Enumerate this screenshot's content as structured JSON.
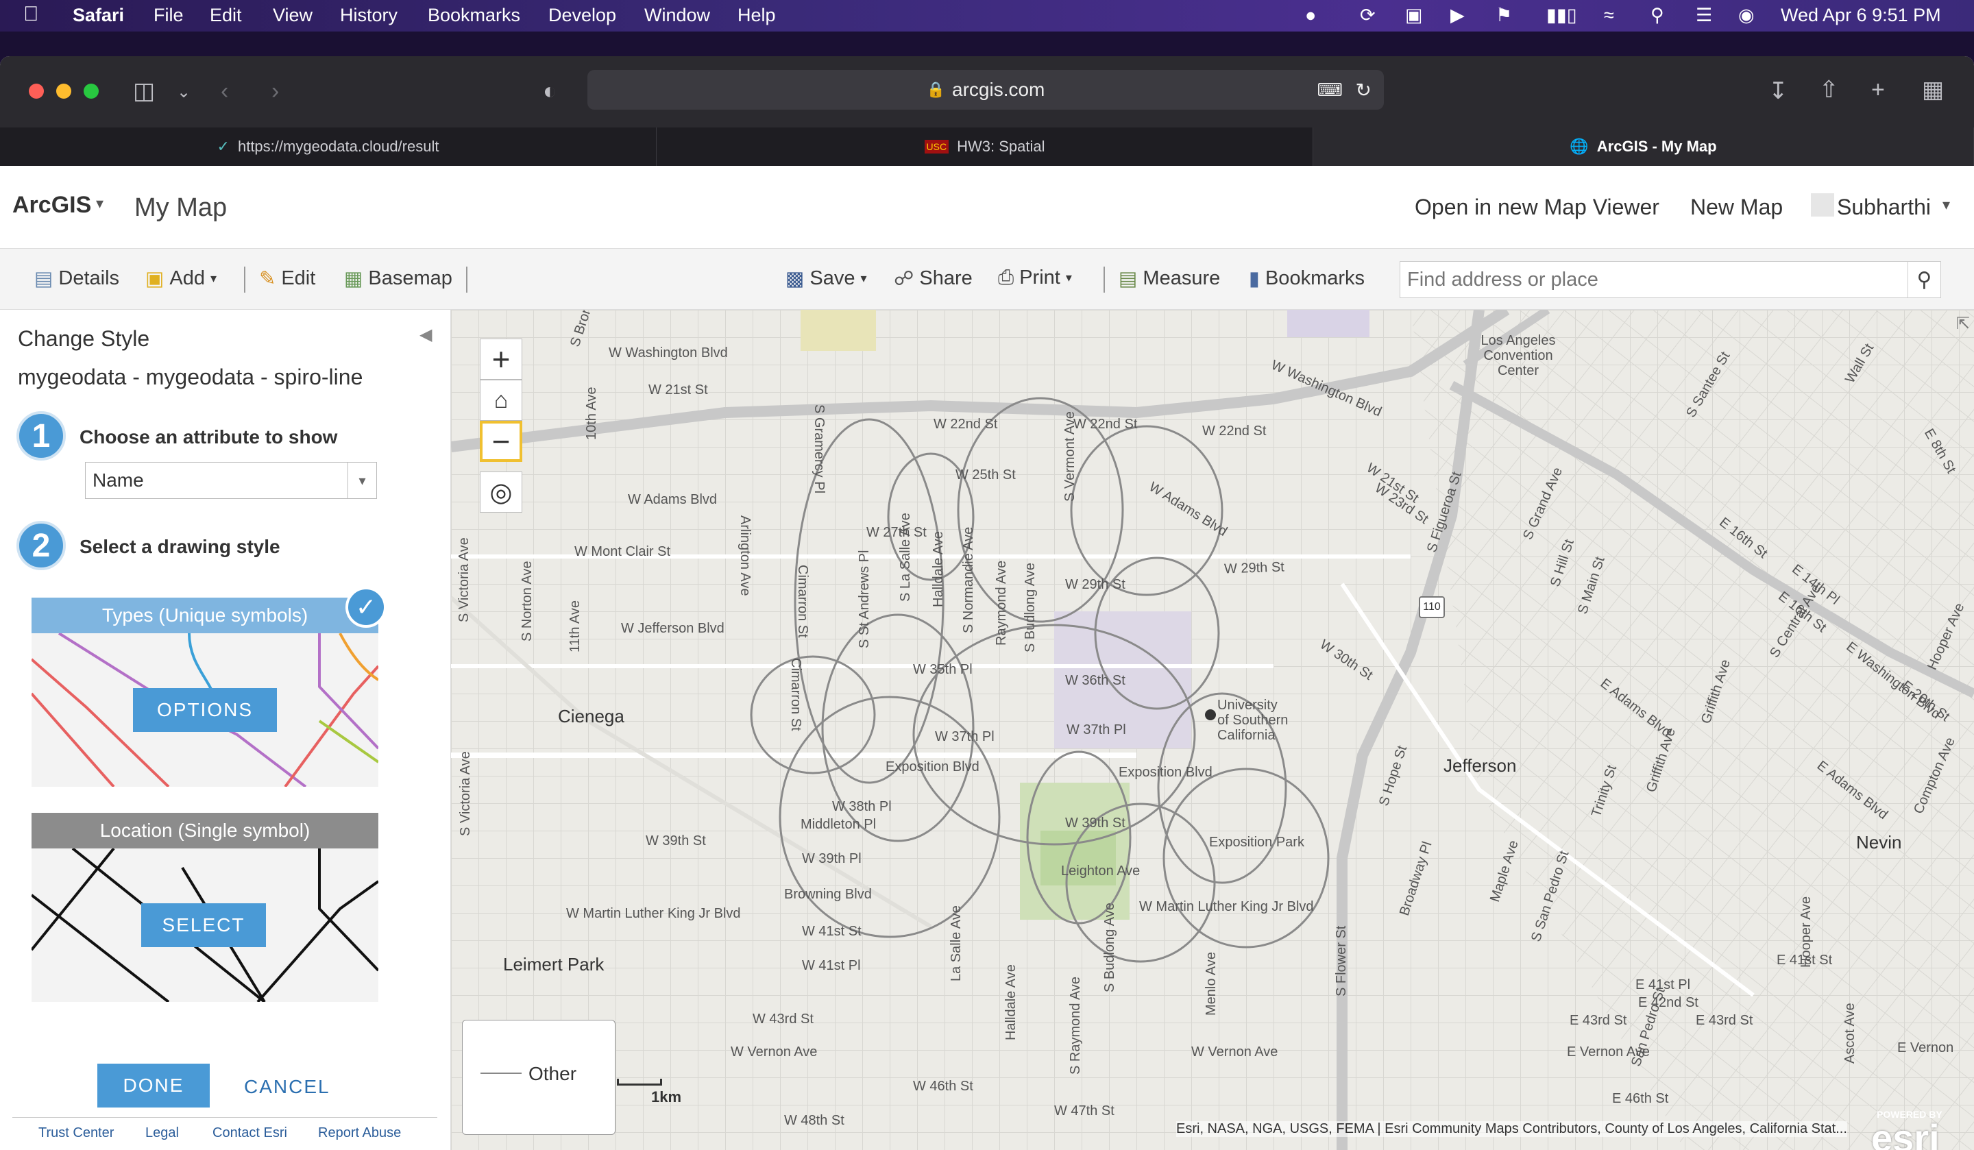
{
  "menubar": {
    "app": "Safari",
    "items": [
      "File",
      "Edit",
      "View",
      "History",
      "Bookmarks",
      "Develop",
      "Window",
      "Help"
    ],
    "clock": "Wed Apr 6  9:51 PM"
  },
  "browser": {
    "address": "arcgis.com",
    "tabs": [
      {
        "label": "https://mygeodata.cloud/result"
      },
      {
        "label": "HW3: Spatial"
      },
      {
        "label": "ArcGIS - My Map"
      }
    ]
  },
  "app": {
    "brand": "ArcGIS",
    "map_title": "My Map",
    "open_new_viewer": "Open in new Map Viewer",
    "new_map": "New Map",
    "user": "Subharthi"
  },
  "toolbar": {
    "details": "Details",
    "add": "Add",
    "edit": "Edit",
    "basemap": "Basemap",
    "save": "Save",
    "share": "Share",
    "print": "Print",
    "measure": "Measure",
    "bookmarks": "Bookmarks",
    "search_placeholder": "Find address or place"
  },
  "panel": {
    "heading": "Change Style",
    "layer": "mygeodata - mygeodata - spiro-line",
    "step1_num": "1",
    "step1": "Choose an attribute to show",
    "attribute_value": "Name",
    "step2_num": "2",
    "step2": "Select a drawing style",
    "card1_title": "Types (Unique symbols)",
    "card1_button": "OPTIONS",
    "card2_title": "Location (Single symbol)",
    "card2_button": "SELECT",
    "done": "DONE",
    "cancel": "CANCEL",
    "footer": [
      "Trust Center",
      "Legal",
      "Contact Esri",
      "Report Abuse"
    ]
  },
  "map": {
    "legend_label": "Other",
    "scale_label": "1km",
    "attribution": "Esri, NASA, NGA, USGS, FEMA | Esri Community Maps Contributors, County of Los Angeles, California Stat...",
    "esri_logo": "esri",
    "esri_powered": "POWERED BY",
    "places": {
      "cienega": "Cienega",
      "jefferson": "Jefferson",
      "leimert": "Leimert Park",
      "nevin": "Nevin",
      "usc": "University of Southern California",
      "lacc": "Los Angeles Convention Center",
      "expo_park": "Exposition Park"
    },
    "streets": {
      "wash1": "W Washington Blvd",
      "s21_1": "W 21st St",
      "s22_1": "W 22nd St",
      "s22_2": "W 22nd St",
      "s22_3": "W 22nd St",
      "s25": "W 25th St",
      "adams": "W Adams Blvd",
      "s27": "W 27th St",
      "montclair": "W Mont Clair St",
      "jefferson_blvd": "W Jefferson Blvd",
      "s35": "W 35th Pl",
      "s36": "W 36th St",
      "s37pl": "W 37th Pl",
      "s37": "W 37th Pl",
      "expo1": "Exposition Blvd",
      "expo2": "Exposition Blvd",
      "s38": "W 38th Pl",
      "middleton": "Middleton Pl",
      "s39": "W 39th St",
      "s39pl": "W 39th Pl",
      "s39b": "W 39th St",
      "browning": "Browning Blvd",
      "leighton": "Leighton Ave",
      "mlk1": "W Martin Luther King Jr Blvd",
      "mlk2": "W Martin Luther King Jr Blvd",
      "s41": "W 41st St",
      "s41pl": "W 41st Pl",
      "s43": "W 43rd St",
      "vernon1": "W Vernon Ave",
      "vernon2": "W Vernon Ave",
      "s46": "W 46th St",
      "s47": "W 47th St",
      "s48": "W 48th St",
      "s29": "W 29th St",
      "s30": "W 30th St",
      "adams2": "W Adams Blvd",
      "s23": "W 23rd St",
      "s21b": "W 21st St",
      "wash2": "W Washington Blvd",
      "e16": "E 16th St",
      "e14": "E 14th Pl",
      "e16b": "E 16th St",
      "ewash": "E Washington Blvd",
      "e20": "E 20th St",
      "eadams": "E Adams Blvd",
      "eadams2": "E Adams Blvd",
      "e41pl": "E 41st Pl",
      "e42": "E 42nd St",
      "e43a": "E 43rd St",
      "e43b": "E 43rd St",
      "evernon": "E Vernon Ave",
      "e46": "E 46th St",
      "e41st": "E 41st St",
      "evernon2": "E Vernon",
      "victoria": "S Victoria Ave",
      "victoria2": "S Victoria Ave",
      "norton": "S Norton Ave",
      "ave11": "11th Ave",
      "ave10": "10th Ave",
      "arlington": "Arlington Ave",
      "cimarron": "Cimarron St",
      "cimarron2": "Cimarron St",
      "gramercy": "S Gramercy Pl",
      "standrews": "S St Andrews Pl",
      "lasalle": "S La Salle Ave",
      "halldale": "Halldale Ave",
      "normandie": "S Normandie Ave",
      "raymond": "Raymond Ave",
      "budlong": "S Budlong Ave",
      "vermont": "S Vermont Ave",
      "figueroa": "S Figueroa St",
      "hope": "S Hope St",
      "grand": "S Grand Ave",
      "hill": "S Hill St",
      "main": "S Main St",
      "broadway": "Broadway Pl",
      "maple": "Maple Ave",
      "sanpedro": "S San Pedro St",
      "trinity": "Trinity St",
      "griffith": "Griffith Ave",
      "central": "S Central Ave",
      "hooper": "Hooper Ave",
      "compton": "Compton Ave",
      "flower": "S Flower St",
      "menlo": "Menlo Ave",
      "santee": "S Santee St",
      "wall": "Wall St",
      "e8": "E 8th St",
      "lasalle2": "La Salle Ave",
      "halldale2": "Halldale Ave",
      "raymond2": "S Raymond Ave",
      "budlong2": "S Budlong Ave",
      "sanpedro2": "San Pedro St",
      "ascot": "Ascot Ave",
      "hooper2": "Hooper Ave",
      "bronson": "S Bronson",
      "hw110": "110"
    }
  },
  "colors": {
    "accent": "#4a9ad6",
    "link": "#2b5d9a",
    "map_bg": "#ecebe6",
    "circle": "#8a8a8a"
  }
}
